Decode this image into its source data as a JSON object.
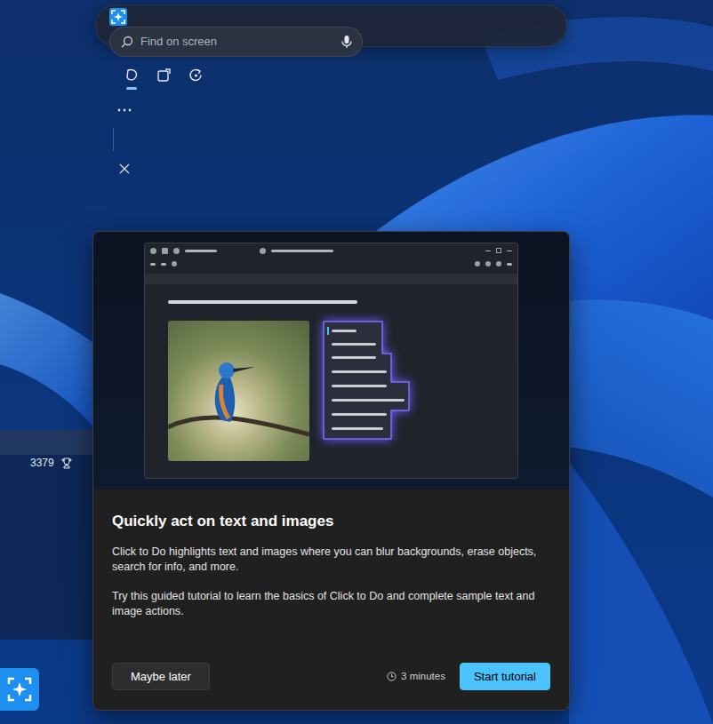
{
  "toolbar": {
    "search": {
      "placeholder": "Find on screen"
    },
    "tools": [
      {
        "selected": true
      },
      {
        "selected": false
      },
      {
        "selected": false
      }
    ]
  },
  "widget": {
    "count": "3379"
  },
  "dialog": {
    "title": "Quickly act on text and images",
    "paragraphs": [
      "Click to Do highlights text and images where you can blur backgrounds, erase objects, search for info, and more.",
      "Try this guided tutorial to learn the basics of Click to Do and complete sample text and image actions."
    ],
    "duration": "3 minutes",
    "buttons": [
      {
        "label": "Maybe later",
        "kind": "secondary"
      },
      {
        "label": "Start tutorial",
        "kind": "primary"
      }
    ]
  }
}
